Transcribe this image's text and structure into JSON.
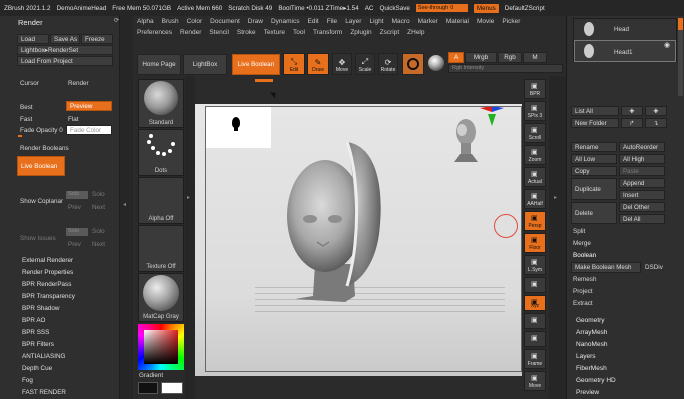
{
  "titlebar": {
    "app": "ZBrush 2021.1.2",
    "doc": "DemoAnimeHead",
    "free_mem": "Free Mem 50.071GB",
    "active_mem": "Active Mem 660",
    "scratch": "Scratch Disk 49",
    "booltime": "BoolTime •0.011 ZTime▸1.54",
    "ac": "AC",
    "quicksave": "QuickSave",
    "see_through": "See-through",
    "see_through_value": "0",
    "menus": "Menus",
    "script": "DefaultZScript"
  },
  "left": {
    "panel_title": "Render",
    "load": "Load",
    "save_as": "Save As",
    "freeze": "Freeze",
    "lightbox_renderset": "Lightbox▸RenderSet",
    "load_from_project": "Load From Project",
    "cursor": "Cursor",
    "render": "Render",
    "best": "Best",
    "preview": "Preview",
    "fast": "Fast",
    "flat": "Flat",
    "fade_opacity": "Fade Opacity 0",
    "fade_color": "Fade Color",
    "render_booleans": "Render Booleans",
    "live_boolean": "Live Boolean",
    "show_coplanar": "Show Coplanar",
    "show_issues": "Show Issues",
    "solo": "Solo",
    "prev": "Prev",
    "next": "Next",
    "sub_menus": [
      "External Renderer",
      "Render Properties",
      "BPR RenderPass",
      "BPR Transparency",
      "BPR Shadow",
      "BPR AO",
      "BPR SSS",
      "BPR Filters",
      "ANTIALIASING",
      "Depth Cue",
      "Fog",
      "FAST RENDER"
    ]
  },
  "menubar": {
    "row1": [
      "Alpha",
      "Brush",
      "Color",
      "Document",
      "Draw",
      "Dynamics",
      "Edit",
      "File",
      "Layer",
      "Light",
      "Macro",
      "Marker",
      "Material",
      "Movie",
      "Picker"
    ],
    "row2": [
      "Preferences",
      "Render",
      "Stencil",
      "Stroke",
      "Texture",
      "Tool",
      "Transform",
      "Zplugin",
      "Zscript",
      "ZHelp"
    ]
  },
  "toolbar": {
    "home_page": "Home Page",
    "lightbox": "LightBox",
    "live_boolean": "Live Boolean",
    "edit": "Edit",
    "draw": "Draw",
    "move": "Move",
    "scale": "Scale",
    "rotate": "Rotate",
    "a": "A",
    "mrgb": "Mrgb",
    "rgb": "Rgb",
    "m": "M",
    "rgb_intensity": "Rgb Intensity"
  },
  "shelf": {
    "standard": "Standard",
    "dots": "Dots",
    "alpha_off": "Alpha Off",
    "texture_off": "Texture Off",
    "matcap_gray": "MatCap Gray",
    "gradient": "Gradient"
  },
  "right_tools": [
    "BPR",
    "SPix 3",
    "Scroll",
    "Zoom",
    "Actual",
    "AAHalf",
    "Persp",
    "Floor",
    "L.Sym",
    "",
    "Xyz",
    "",
    "",
    "Frame",
    "Move"
  ],
  "right": {
    "tools": [
      {
        "name": "Head"
      },
      {
        "name": "Head1"
      }
    ],
    "list_all": "List All",
    "new_folder": "New Folder",
    "rename": "Rename",
    "auto_reorder": "AutoReorder",
    "all_low": "All Low",
    "all_high": "All High",
    "copy": "Copy",
    "paste": "Paste",
    "duplicate": "Duplicate",
    "append": "Append",
    "insert": "Insert",
    "delete": "Delete",
    "del_other": "Del Other",
    "del_all": "Del All",
    "split": "Split",
    "merge": "Merge",
    "boolean": "Boolean",
    "make_boolean_mesh": "Make Boolean Mesh",
    "dsdiv": "DSDiv",
    "remesh": "Remesh",
    "project": "Project",
    "extract": "Extract",
    "sub_menus": [
      "Geometry",
      "ArrayMesh",
      "NanoMesh",
      "Layers",
      "FiberMesh",
      "Geometry HD",
      "Preview"
    ]
  },
  "colors": {
    "accent": "#e8701c",
    "panel": "#2f2f2f",
    "canvas": "#e4e4e4"
  }
}
